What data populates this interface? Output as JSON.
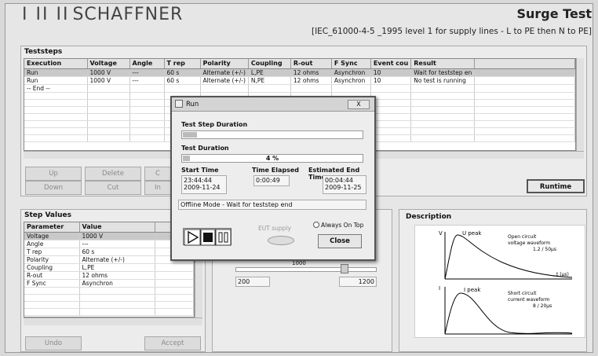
{
  "header": {
    "logo_bars": "I II II",
    "logo_text": "SCHAFFNER",
    "title": "Surge Test",
    "subtitle": "[IEC_61000-4-5 _1995 level 1 for supply lines - L to PE then N to PE]"
  },
  "teststeps": {
    "title": "Teststeps",
    "columns": [
      "Execution",
      "Voltage",
      "Angle",
      "T rep",
      "Polarity",
      "Coupling",
      "R-out",
      "F Sync",
      "Event cou",
      "Result"
    ],
    "rows": [
      [
        "Run",
        "1000 V",
        "---",
        "60 s",
        "Alternate (+/-)",
        "L,PE",
        "12 ohms",
        "Asynchron",
        "10",
        "Wait for teststep en"
      ],
      [
        "Run",
        "1000 V",
        "---",
        "60 s",
        "Alternate (+/-)",
        "N,PE",
        "12 ohms",
        "Asynchron",
        "10",
        "No test is running"
      ],
      [
        "-- End --",
        "",
        "",
        "",
        "",
        "",
        "",
        "",
        "",
        ""
      ]
    ],
    "buttons": {
      "up": "Up",
      "delete": "Delete",
      "copy": "C",
      "down": "Down",
      "cut": "Cut",
      "insert": "In",
      "runtime": "Runtime"
    }
  },
  "step_values": {
    "title": "Step Values",
    "columns": [
      "Parameter",
      "Value"
    ],
    "rows": [
      [
        "Voltage",
        "1000 V"
      ],
      [
        "Angle",
        "---"
      ],
      [
        "T rep",
        "60 s"
      ],
      [
        "Polarity",
        "Alternate (+/-)"
      ],
      [
        "Coupling",
        "L,PE"
      ],
      [
        "R-out",
        "12 ohms"
      ],
      [
        "F Sync",
        "Asynchron"
      ]
    ],
    "undo": "Undo",
    "accept": "Accept"
  },
  "slider": {
    "top_value": "1000",
    "min_label": "200",
    "max_label": "1200"
  },
  "description": {
    "title": "Description",
    "upeak": "U peak",
    "open_circuit": "Open circuit",
    "voltage_waveform": "voltage waveform",
    "voltage_timing": "1.2 / 50µs",
    "t_unit": "t (µs)",
    "ipeak": "I peak",
    "short_circuit": "Short circuit",
    "current_waveform": "current waveform",
    "current_timing": "8 / 20µs",
    "u_axis": "V",
    "i_axis": "I"
  },
  "run_dialog": {
    "title": "Run",
    "close_x": "X",
    "test_step_duration_label": "Test Step Duration",
    "test_step_progress": 0.08,
    "test_duration_label": "Test Duration",
    "test_duration_progress": 0.04,
    "test_duration_pct": "4 %",
    "start_time_label": "Start Time",
    "start_time": "23:44:44",
    "start_date": "2009-11-24",
    "elapsed_label": "Time Elapsed",
    "elapsed": "0:00:49",
    "end_label": "Estimated End Time",
    "end_time": "00:04:44",
    "end_date": "2009-11-25",
    "status": "Offline Mode - Wait for teststep end",
    "eut_supply": "EUT supply",
    "always_on_top": "Always On Top",
    "close_button": "Close"
  }
}
